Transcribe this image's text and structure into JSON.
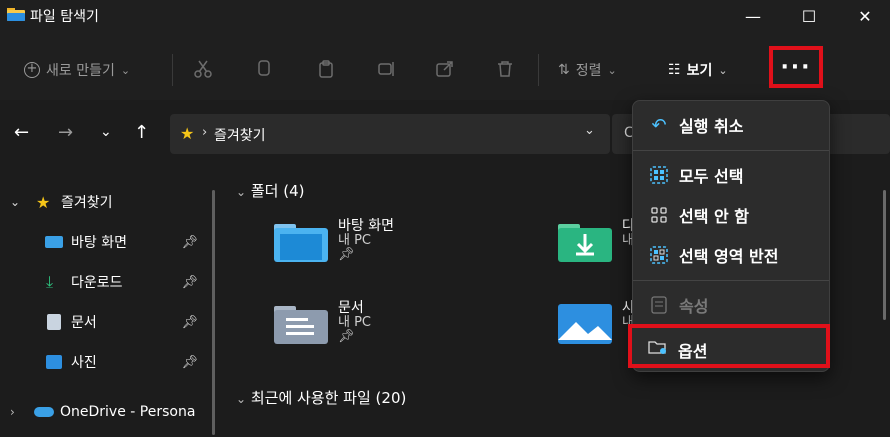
{
  "window": {
    "title": "파일 탐색기",
    "minimize": "—",
    "maximize": "☐",
    "close": "✕"
  },
  "toolbar": {
    "new_label": "새로 만들기",
    "sort_label": "정렬",
    "view_label": "보기",
    "more_label": "···"
  },
  "address": {
    "path": "즐겨찾기"
  },
  "sidebar": {
    "items": [
      {
        "label": "즐겨찾기"
      },
      {
        "label": "바탕 화면"
      },
      {
        "label": "다운로드"
      },
      {
        "label": "문서"
      },
      {
        "label": "사진"
      },
      {
        "label": "OneDrive - Persona"
      }
    ]
  },
  "content": {
    "folders_header": "폴더 (4)",
    "folders": [
      {
        "name": "바탕 화면",
        "location": "내 PC"
      },
      {
        "name": "다",
        "location": "내"
      },
      {
        "name": "문서",
        "location": "내 PC"
      },
      {
        "name": "사",
        "location": "내"
      }
    ],
    "recent_header": "최근에 사용한 파일 (20)"
  },
  "menu": {
    "items": [
      {
        "label": "실행 취소"
      },
      {
        "label": "모두 선택"
      },
      {
        "label": "선택 안 함"
      },
      {
        "label": "선택 영역 반전"
      },
      {
        "label": "속성"
      },
      {
        "label": "옵션"
      }
    ]
  },
  "colors": {
    "accent": "#4cc2ff",
    "highlight": "#e0101a",
    "menu_bg": "#2c2c2c"
  }
}
